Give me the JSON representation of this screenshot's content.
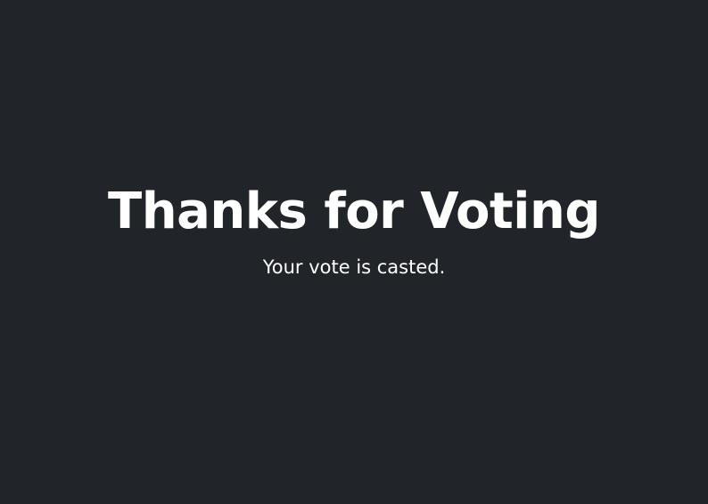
{
  "theme": {
    "background": "#212529",
    "text_color": "#ffffff"
  },
  "confirmation": {
    "heading": "Thanks for Voting",
    "message": "Your vote is casted."
  }
}
